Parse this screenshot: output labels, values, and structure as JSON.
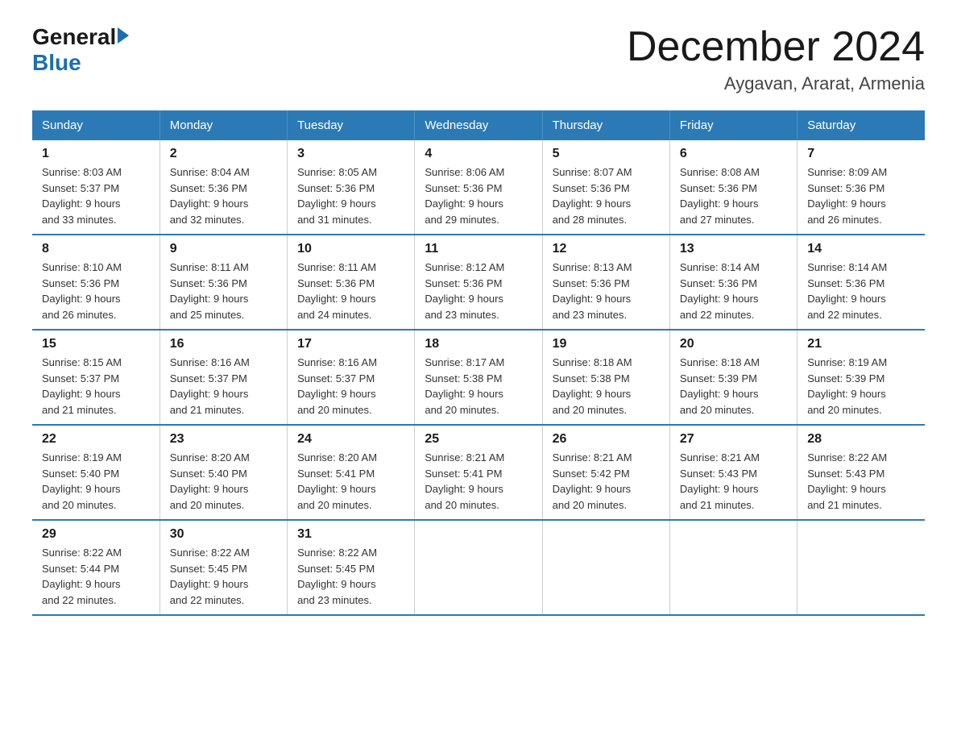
{
  "header": {
    "logo_general": "General",
    "logo_blue": "Blue",
    "month_title": "December 2024",
    "location": "Aygavan, Ararat, Armenia"
  },
  "weekdays": [
    "Sunday",
    "Monday",
    "Tuesday",
    "Wednesday",
    "Thursday",
    "Friday",
    "Saturday"
  ],
  "weeks": [
    [
      {
        "day": "1",
        "sunrise": "8:03 AM",
        "sunset": "5:37 PM",
        "daylight": "9 hours and 33 minutes."
      },
      {
        "day": "2",
        "sunrise": "8:04 AM",
        "sunset": "5:36 PM",
        "daylight": "9 hours and 32 minutes."
      },
      {
        "day": "3",
        "sunrise": "8:05 AM",
        "sunset": "5:36 PM",
        "daylight": "9 hours and 31 minutes."
      },
      {
        "day": "4",
        "sunrise": "8:06 AM",
        "sunset": "5:36 PM",
        "daylight": "9 hours and 29 minutes."
      },
      {
        "day": "5",
        "sunrise": "8:07 AM",
        "sunset": "5:36 PM",
        "daylight": "9 hours and 28 minutes."
      },
      {
        "day": "6",
        "sunrise": "8:08 AM",
        "sunset": "5:36 PM",
        "daylight": "9 hours and 27 minutes."
      },
      {
        "day": "7",
        "sunrise": "8:09 AM",
        "sunset": "5:36 PM",
        "daylight": "9 hours and 26 minutes."
      }
    ],
    [
      {
        "day": "8",
        "sunrise": "8:10 AM",
        "sunset": "5:36 PM",
        "daylight": "9 hours and 26 minutes."
      },
      {
        "day": "9",
        "sunrise": "8:11 AM",
        "sunset": "5:36 PM",
        "daylight": "9 hours and 25 minutes."
      },
      {
        "day": "10",
        "sunrise": "8:11 AM",
        "sunset": "5:36 PM",
        "daylight": "9 hours and 24 minutes."
      },
      {
        "day": "11",
        "sunrise": "8:12 AM",
        "sunset": "5:36 PM",
        "daylight": "9 hours and 23 minutes."
      },
      {
        "day": "12",
        "sunrise": "8:13 AM",
        "sunset": "5:36 PM",
        "daylight": "9 hours and 23 minutes."
      },
      {
        "day": "13",
        "sunrise": "8:14 AM",
        "sunset": "5:36 PM",
        "daylight": "9 hours and 22 minutes."
      },
      {
        "day": "14",
        "sunrise": "8:14 AM",
        "sunset": "5:36 PM",
        "daylight": "9 hours and 22 minutes."
      }
    ],
    [
      {
        "day": "15",
        "sunrise": "8:15 AM",
        "sunset": "5:37 PM",
        "daylight": "9 hours and 21 minutes."
      },
      {
        "day": "16",
        "sunrise": "8:16 AM",
        "sunset": "5:37 PM",
        "daylight": "9 hours and 21 minutes."
      },
      {
        "day": "17",
        "sunrise": "8:16 AM",
        "sunset": "5:37 PM",
        "daylight": "9 hours and 20 minutes."
      },
      {
        "day": "18",
        "sunrise": "8:17 AM",
        "sunset": "5:38 PM",
        "daylight": "9 hours and 20 minutes."
      },
      {
        "day": "19",
        "sunrise": "8:18 AM",
        "sunset": "5:38 PM",
        "daylight": "9 hours and 20 minutes."
      },
      {
        "day": "20",
        "sunrise": "8:18 AM",
        "sunset": "5:39 PM",
        "daylight": "9 hours and 20 minutes."
      },
      {
        "day": "21",
        "sunrise": "8:19 AM",
        "sunset": "5:39 PM",
        "daylight": "9 hours and 20 minutes."
      }
    ],
    [
      {
        "day": "22",
        "sunrise": "8:19 AM",
        "sunset": "5:40 PM",
        "daylight": "9 hours and 20 minutes."
      },
      {
        "day": "23",
        "sunrise": "8:20 AM",
        "sunset": "5:40 PM",
        "daylight": "9 hours and 20 minutes."
      },
      {
        "day": "24",
        "sunrise": "8:20 AM",
        "sunset": "5:41 PM",
        "daylight": "9 hours and 20 minutes."
      },
      {
        "day": "25",
        "sunrise": "8:21 AM",
        "sunset": "5:41 PM",
        "daylight": "9 hours and 20 minutes."
      },
      {
        "day": "26",
        "sunrise": "8:21 AM",
        "sunset": "5:42 PM",
        "daylight": "9 hours and 20 minutes."
      },
      {
        "day": "27",
        "sunrise": "8:21 AM",
        "sunset": "5:43 PM",
        "daylight": "9 hours and 21 minutes."
      },
      {
        "day": "28",
        "sunrise": "8:22 AM",
        "sunset": "5:43 PM",
        "daylight": "9 hours and 21 minutes."
      }
    ],
    [
      {
        "day": "29",
        "sunrise": "8:22 AM",
        "sunset": "5:44 PM",
        "daylight": "9 hours and 22 minutes."
      },
      {
        "day": "30",
        "sunrise": "8:22 AM",
        "sunset": "5:45 PM",
        "daylight": "9 hours and 22 minutes."
      },
      {
        "day": "31",
        "sunrise": "8:22 AM",
        "sunset": "5:45 PM",
        "daylight": "9 hours and 23 minutes."
      },
      null,
      null,
      null,
      null
    ]
  ],
  "labels": {
    "sunrise": "Sunrise:",
    "sunset": "Sunset:",
    "daylight": "Daylight:"
  }
}
